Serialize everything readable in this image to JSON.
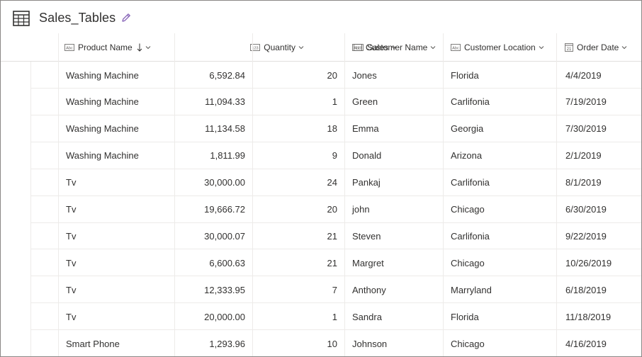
{
  "title": "Sales_Tables",
  "icons": {
    "table": "table-icon",
    "edit": "pencil-icon"
  },
  "columns": [
    {
      "key": "product",
      "label": "Product Name",
      "type_icon": "text-type-icon",
      "sorted": true
    },
    {
      "key": "sales",
      "label": "Sales",
      "type_icon": "number-type-icon"
    },
    {
      "key": "quantity",
      "label": "Quantity",
      "type_icon": "number-type-icon"
    },
    {
      "key": "customer",
      "label": "Customer Name",
      "type_icon": "text-type-icon"
    },
    {
      "key": "location",
      "label": "Customer Location",
      "type_icon": "text-type-icon"
    },
    {
      "key": "date",
      "label": "Order Date",
      "type_icon": "calendar-type-icon"
    }
  ],
  "rows": [
    {
      "product": "Washing Machine",
      "sales": "6,592.84",
      "quantity": "20",
      "customer": "Jones",
      "location": "Florida",
      "date": "4/4/2019"
    },
    {
      "product": "Washing Machine",
      "sales": "11,094.33",
      "quantity": "1",
      "customer": "Green",
      "location": "Carlifonia",
      "date": "7/19/2019"
    },
    {
      "product": "Washing Machine",
      "sales": "11,134.58",
      "quantity": "18",
      "customer": "Emma",
      "location": "Georgia",
      "date": "7/30/2019"
    },
    {
      "product": "Washing Machine",
      "sales": "1,811.99",
      "quantity": "9",
      "customer": "Donald",
      "location": "Arizona",
      "date": "2/1/2019"
    },
    {
      "product": "Tv",
      "sales": "30,000.00",
      "quantity": "24",
      "customer": "Pankaj",
      "location": "Carlifonia",
      "date": "8/1/2019"
    },
    {
      "product": "Tv",
      "sales": "19,666.72",
      "quantity": "20",
      "customer": "john",
      "location": "Chicago",
      "date": "6/30/2019"
    },
    {
      "product": "Tv",
      "sales": "30,000.07",
      "quantity": "21",
      "customer": "Steven",
      "location": "Carlifonia",
      "date": "9/22/2019"
    },
    {
      "product": "Tv",
      "sales": "6,600.63",
      "quantity": "21",
      "customer": "Margret",
      "location": "Chicago",
      "date": "10/26/2019"
    },
    {
      "product": "Tv",
      "sales": "12,333.95",
      "quantity": "7",
      "customer": "Anthony",
      "location": "Marryland",
      "date": "6/18/2019"
    },
    {
      "product": "Tv",
      "sales": "20,000.00",
      "quantity": "1",
      "customer": "Sandra",
      "location": "Florida",
      "date": "11/18/2019"
    },
    {
      "product": "Smart Phone",
      "sales": "1,293.96",
      "quantity": "10",
      "customer": "Johnson",
      "location": "Chicago",
      "date": "4/16/2019"
    }
  ]
}
